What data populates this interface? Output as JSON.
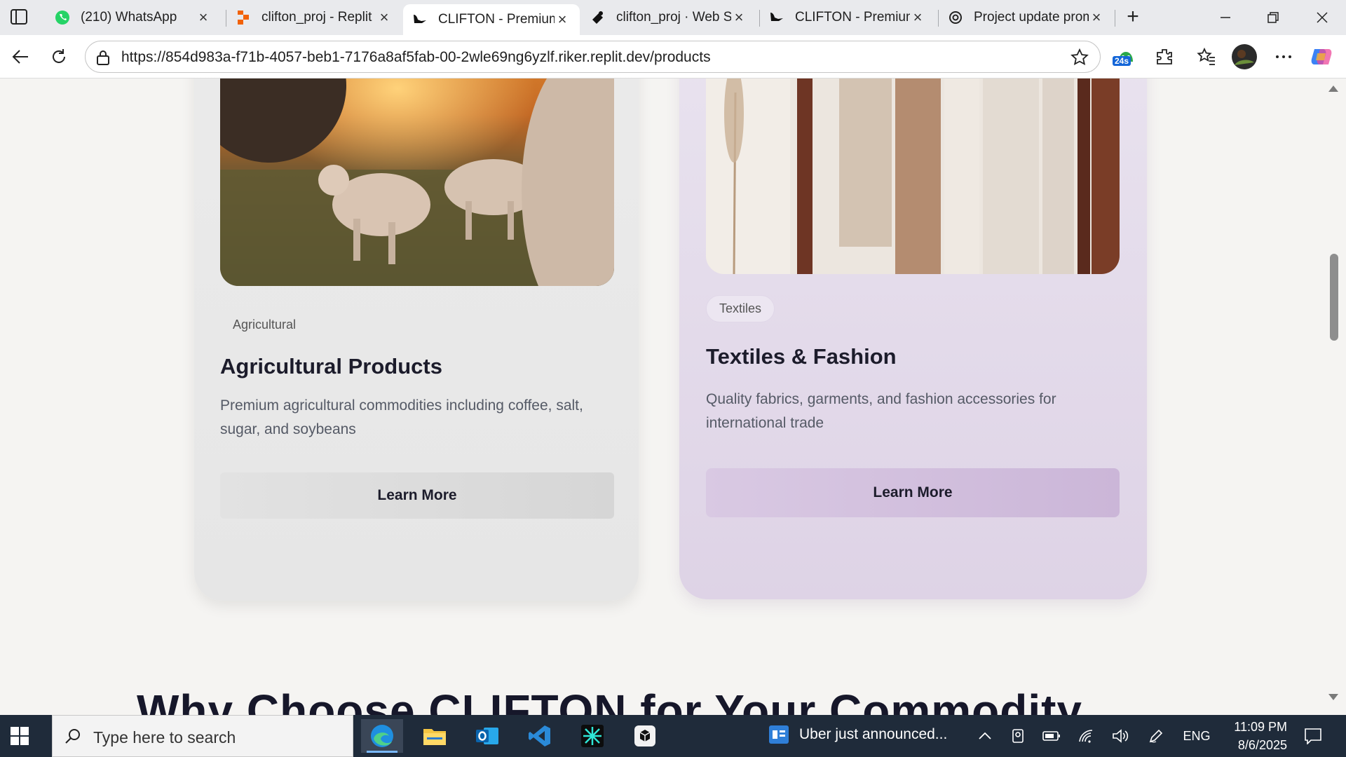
{
  "browser": {
    "tabs": [
      {
        "title": "(210) WhatsApp",
        "icon": "whatsapp-icon"
      },
      {
        "title": "clifton_proj - Replit",
        "icon": "replit-icon"
      },
      {
        "title": "CLIFTON - Premium",
        "icon": "clifton-logo-icon",
        "active": true
      },
      {
        "title": "clifton_proj · Web Se",
        "icon": "replit-web-icon"
      },
      {
        "title": "CLIFTON - Premium",
        "icon": "clifton-logo-icon"
      },
      {
        "title": "Project update prom",
        "icon": "chatgpt-icon"
      }
    ],
    "url": "https://854d983a-f71b-4057-beb1-7176a8af5fab-00-2wle69ng6yzlf.riker.replit.dev/products",
    "extension_badge": "24s"
  },
  "page": {
    "cards": [
      {
        "category": "Agricultural",
        "title": "Agricultural Products",
        "description": "Premium agricultural commodities including coffee, salt, sugar, and soybeans",
        "button": "Learn More"
      },
      {
        "category": "Textiles",
        "title": "Textiles & Fashion",
        "description": "Quality fabrics, garments, and fashion accessories for international trade",
        "button": "Learn More"
      }
    ],
    "section_heading": "Why Choose CLIFTON for Your Commodity"
  },
  "taskbar": {
    "search_placeholder": "Type here to search",
    "notification": "Uber just announced...",
    "language": "ENG",
    "time": "11:09 PM",
    "date": "8/6/2025"
  },
  "colors": {
    "agri_card": "#e8e8e8",
    "tex_card": "#e3daea",
    "tex_button": "#d0bedc",
    "taskbar": "#1f2b3a"
  }
}
